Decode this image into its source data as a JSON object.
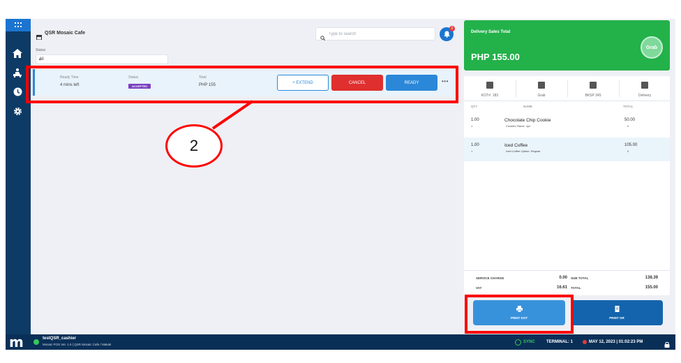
{
  "sidebar": {
    "icons": [
      "grid-icon",
      "home-icon",
      "delivery-icon",
      "clock-icon",
      "gear-icon"
    ]
  },
  "header": {
    "store_name": "QSR Mosaic Cafe",
    "search_placeholder": "Type to search",
    "notification_count": "0"
  },
  "filter": {
    "status_label": "Status",
    "status_value": "All"
  },
  "order": {
    "ready_time_label": "Ready Time",
    "ready_time_value": "4 mins left",
    "status_label": "Status",
    "status_value": "ACCEPTED",
    "total_label": "Total",
    "total_value": "PHP 155",
    "extend_label": "+ EXTEND",
    "cancel_label": "CANCEL",
    "ready_label": "READY",
    "more_label": "•••"
  },
  "summary_panel": {
    "title": "Delivery Sales Total",
    "amount": "PHP 155.00",
    "provider_badge": "Grab",
    "tabs": [
      {
        "label": "KOT#: 183",
        "icon": "receipt-icon"
      },
      {
        "label": "Grab",
        "icon": "user-icon"
      },
      {
        "label": "BKSP 245",
        "icon": "document-icon"
      },
      {
        "label": "Delivery",
        "icon": "eject-icon"
      }
    ],
    "columns": {
      "qty": "QTY",
      "name": "NAME",
      "total": "TOTAL"
    },
    "items": [
      {
        "qty": "1.00",
        "qty_sub": "1",
        "name": "Chocolate Chip Cookie",
        "modifier": "Cookies Flavor: 1pc",
        "total": "50.00",
        "total_sub": "0"
      },
      {
        "qty": "1.00",
        "qty_sub": "1",
        "name": "Iced Coffee",
        "modifier": "Iced Coffee Option: Regular",
        "total": "105.00",
        "total_sub": "0"
      }
    ],
    "totals": {
      "service_charge_label": "SERVICE CHARGE",
      "service_charge_value": "0.00",
      "sub_total_label": "SUB TOTAL",
      "sub_total_value": "138.39",
      "vat_label": "VAT",
      "vat_value": "16.61",
      "total_label": "TOTAL",
      "total_value": "155.00"
    },
    "print_kot_label": "PRINT KOT",
    "print_or_label": "PRINT OR"
  },
  "footer": {
    "user": "testQSR_cashier",
    "version": "Mosaic POS Ver. 1.5 | QSR Mosaic Cafe / Makati",
    "sync_label": "SYNC",
    "terminal": "TERMINAL: 1",
    "datetime": "MAY 12, 2023 | 01:02:23 PM"
  },
  "annotation": {
    "callout_number": "2"
  },
  "colors": {
    "sidebar": "#0d3b66",
    "primary": "#2b88d8",
    "cancel": "#e02f2f",
    "success": "#23b14a",
    "accepted_badge": "#7c3fc4",
    "annotation": "#ff0000"
  }
}
